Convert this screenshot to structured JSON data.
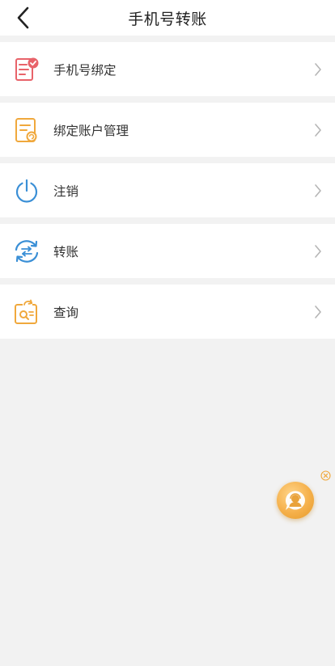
{
  "header": {
    "title": "手机号转账",
    "back_icon": "chevron-left-icon"
  },
  "menu": {
    "items": [
      {
        "label": "手机号绑定",
        "icon": "phone-binding-icon",
        "color": "#e8636a"
      },
      {
        "label": "绑定账户管理",
        "icon": "account-manage-icon",
        "color": "#f0a83c"
      },
      {
        "label": "注销",
        "icon": "power-icon",
        "color": "#3a8fd6"
      },
      {
        "label": "转账",
        "icon": "transfer-icon",
        "color": "#3a8fd6"
      },
      {
        "label": "查询",
        "icon": "query-icon",
        "color": "#f0a83c"
      }
    ]
  },
  "floating": {
    "service_icon": "customer-service-icon",
    "close_icon": "close-circle-icon"
  }
}
